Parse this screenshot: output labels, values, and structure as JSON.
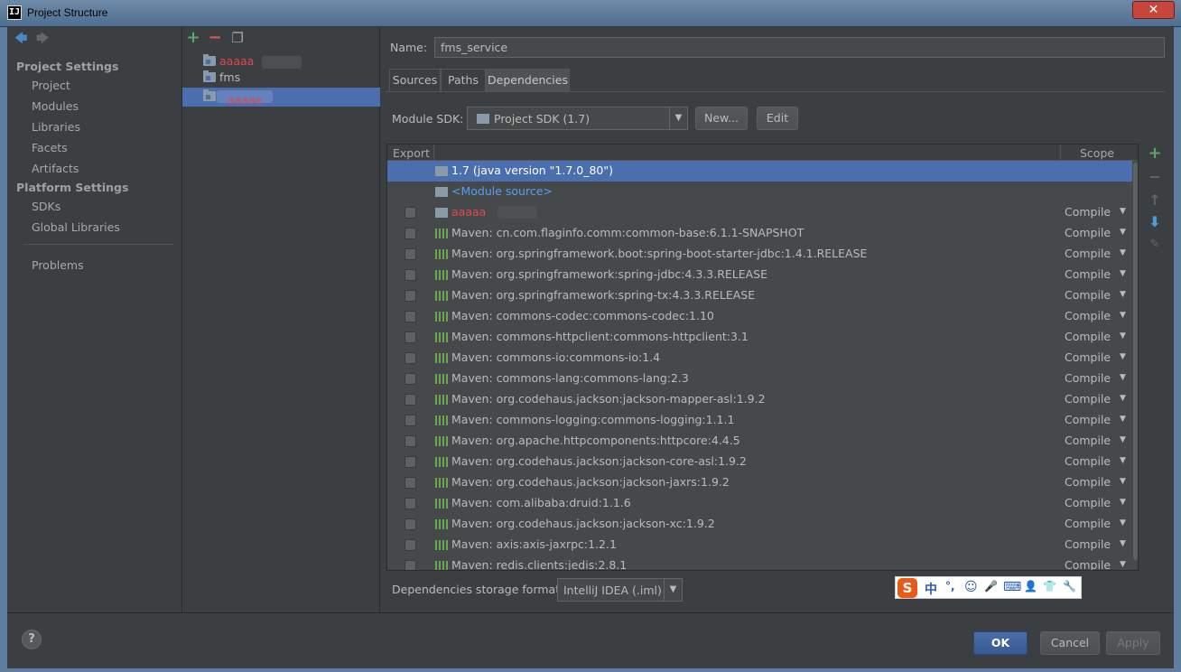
{
  "window": {
    "title": "Project Structure",
    "app_icon_glyph": "IJ",
    "close_glyph": "✕"
  },
  "nav": {
    "back_glyph": "🡄",
    "forward_glyph": "🡆",
    "project_settings_header": "Project Settings",
    "project_settings_items": [
      "Project",
      "Modules",
      "Libraries",
      "Facets",
      "Artifacts"
    ],
    "platform_settings_header": "Platform Settings",
    "platform_settings_items": [
      "SDKs",
      "Global Libraries"
    ],
    "problems": "Problems"
  },
  "module_tree": {
    "toolbar": {
      "add": "+",
      "remove": "−",
      "copy": "❐"
    },
    "items": [
      {
        "label": "aaaaa",
        "redacted": true,
        "selected": false
      },
      {
        "label": "fms",
        "redacted": false,
        "selected": false
      },
      {
        "label": "aaaaa",
        "redacted": true,
        "selected": true
      }
    ]
  },
  "detail": {
    "name_label": "Name:",
    "name_value": "fms_service",
    "tabs": [
      {
        "label": "Sources",
        "active": false
      },
      {
        "label": "Paths",
        "active": false
      },
      {
        "label": "Dependencies",
        "active": true
      }
    ],
    "module_sdk_label": "Module SDK:",
    "module_sdk_value": "Project SDK (1.7)",
    "new_button": "New...",
    "edit_button": "Edit",
    "table": {
      "col_export": "Export",
      "col_scope": "Scope",
      "rows": [
        {
          "text": "1.7 (java version \"1.7.0_80\")",
          "icon": "folder",
          "checkbox": false,
          "scope": "",
          "selected": true,
          "link": false
        },
        {
          "text": "<Module source>",
          "icon": "folder",
          "checkbox": false,
          "scope": "",
          "selected": false,
          "link": true
        },
        {
          "text": "aaaaa",
          "icon": "folder",
          "checkbox": true,
          "scope": "Compile",
          "selected": false,
          "link": false,
          "redacted": true
        },
        {
          "text": "Maven: cn.com.flaginfo.comm:common-base:6.1.1-SNAPSHOT",
          "icon": "maven",
          "checkbox": true,
          "scope": "Compile"
        },
        {
          "text": "Maven: org.springframework.boot:spring-boot-starter-jdbc:1.4.1.RELEASE",
          "icon": "maven",
          "checkbox": true,
          "scope": "Compile"
        },
        {
          "text": "Maven: org.springframework:spring-jdbc:4.3.3.RELEASE",
          "icon": "maven",
          "checkbox": true,
          "scope": "Compile"
        },
        {
          "text": "Maven: org.springframework:spring-tx:4.3.3.RELEASE",
          "icon": "maven",
          "checkbox": true,
          "scope": "Compile"
        },
        {
          "text": "Maven: commons-codec:commons-codec:1.10",
          "icon": "maven",
          "checkbox": true,
          "scope": "Compile"
        },
        {
          "text": "Maven: commons-httpclient:commons-httpclient:3.1",
          "icon": "maven",
          "checkbox": true,
          "scope": "Compile"
        },
        {
          "text": "Maven: commons-io:commons-io:1.4",
          "icon": "maven",
          "checkbox": true,
          "scope": "Compile"
        },
        {
          "text": "Maven: commons-lang:commons-lang:2.3",
          "icon": "maven",
          "checkbox": true,
          "scope": "Compile"
        },
        {
          "text": "Maven: org.codehaus.jackson:jackson-mapper-asl:1.9.2",
          "icon": "maven",
          "checkbox": true,
          "scope": "Compile"
        },
        {
          "text": "Maven: commons-logging:commons-logging:1.1.1",
          "icon": "maven",
          "checkbox": true,
          "scope": "Compile"
        },
        {
          "text": "Maven: org.apache.httpcomponents:httpcore:4.4.5",
          "icon": "maven",
          "checkbox": true,
          "scope": "Compile"
        },
        {
          "text": "Maven: org.codehaus.jackson:jackson-core-asl:1.9.2",
          "icon": "maven",
          "checkbox": true,
          "scope": "Compile"
        },
        {
          "text": "Maven: org.codehaus.jackson:jackson-jaxrs:1.9.2",
          "icon": "maven",
          "checkbox": true,
          "scope": "Compile"
        },
        {
          "text": "Maven: com.alibaba:druid:1.1.6",
          "icon": "maven",
          "checkbox": true,
          "scope": "Compile"
        },
        {
          "text": "Maven: org.codehaus.jackson:jackson-xc:1.9.2",
          "icon": "maven",
          "checkbox": true,
          "scope": "Compile"
        },
        {
          "text": "Maven: axis:axis-jaxrpc:1.2.1",
          "icon": "maven",
          "checkbox": true,
          "scope": "Compile"
        },
        {
          "text": "Maven: redis.clients:jedis:2.8.1",
          "icon": "maven",
          "checkbox": true,
          "scope": "Compile"
        }
      ]
    },
    "side_toolbar": {
      "add": "+",
      "remove": "−",
      "up": "↑",
      "down": "⬇",
      "edit": "✎"
    },
    "storage_format_label": "Dependencies storage format:",
    "storage_format_value": "IntelliJ IDEA (.iml)"
  },
  "ime_bar": {
    "logo": "S",
    "glyphs": [
      "中",
      "°,",
      "☺",
      "🎤",
      "⌨",
      "👤",
      "👕",
      "🔧"
    ]
  },
  "footer": {
    "help": "?",
    "ok": "OK",
    "cancel": "Cancel",
    "apply": "Apply"
  },
  "colors": {
    "background": "#3c3f41",
    "selection": "#4b6eaf",
    "link": "#589df6",
    "add_green": "#59a869",
    "remove_red": "#e05555",
    "redacted_text": "#e0474f"
  }
}
